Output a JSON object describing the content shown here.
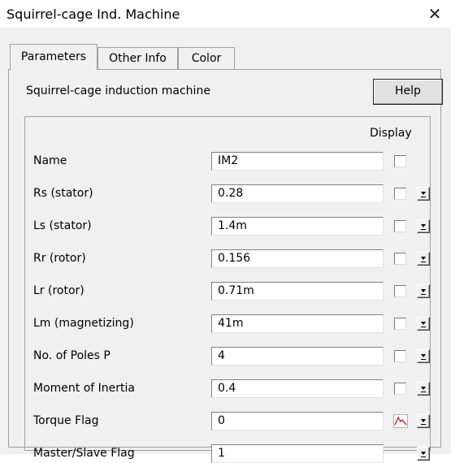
{
  "window": {
    "title": "Squirrel-cage Ind. Machine"
  },
  "tabs": [
    {
      "label": "Parameters",
      "active": true
    },
    {
      "label": "Other Info",
      "active": false
    },
    {
      "label": "Color",
      "active": false
    }
  ],
  "description": "Squirrel-cage induction machine",
  "help_label": "Help",
  "display_header": "Display",
  "params": [
    {
      "label": "Name",
      "value": "IM2",
      "display": "checkbox",
      "dropdown": false
    },
    {
      "label": "Rs (stator)",
      "value": "0.28",
      "display": "checkbox",
      "dropdown": true
    },
    {
      "label": "Ls (stator)",
      "value": "1.4m",
      "display": "checkbox",
      "dropdown": true
    },
    {
      "label": "Rr (rotor)",
      "value": "0.156",
      "display": "checkbox",
      "dropdown": true
    },
    {
      "label": "Lr (rotor)",
      "value": "0.71m",
      "display": "checkbox",
      "dropdown": true
    },
    {
      "label": "Lm (magnetizing)",
      "value": "41m",
      "display": "checkbox",
      "dropdown": true
    },
    {
      "label": "No. of Poles P",
      "value": "4",
      "display": "checkbox",
      "dropdown": true
    },
    {
      "label": "Moment of Inertia",
      "value": "0.4",
      "display": "checkbox",
      "dropdown": true
    },
    {
      "label": "Torque Flag",
      "value": "0",
      "display": "graph-icon",
      "dropdown": true
    },
    {
      "label": "Master/Slave Flag",
      "value": "1",
      "display": "none",
      "dropdown": true
    }
  ],
  "colors": {
    "graph_icon": "#d02020"
  }
}
